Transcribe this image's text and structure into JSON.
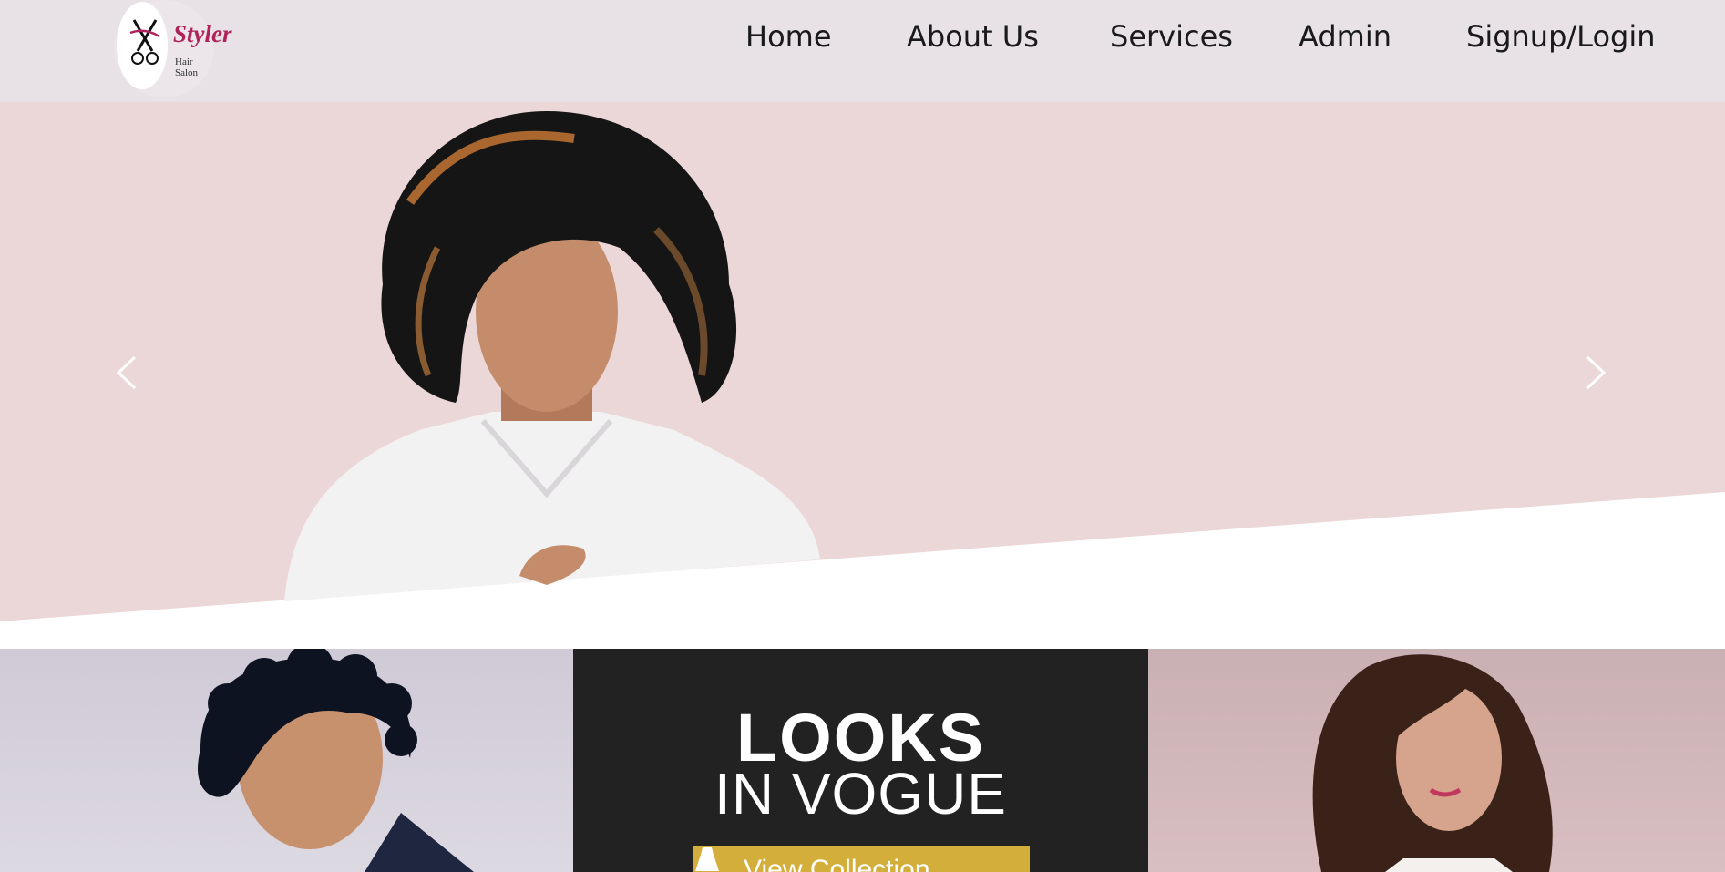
{
  "brand": {
    "name": "Styler",
    "tagline": "Hair Salon",
    "accent": "#b0225a"
  },
  "nav": {
    "home": "Home",
    "about": "About Us",
    "services": "Services",
    "admin": "Admin",
    "signup": "Signup/Login"
  },
  "hero": {
    "background": "#ebd7d7",
    "prev_icon": "chevron-left-icon",
    "next_icon": "chevron-right-icon"
  },
  "promo": {
    "line1": "LOOKS",
    "line2": "IN VOGUE",
    "button_label": "View Collection",
    "button_color": "#d4ae3b"
  }
}
